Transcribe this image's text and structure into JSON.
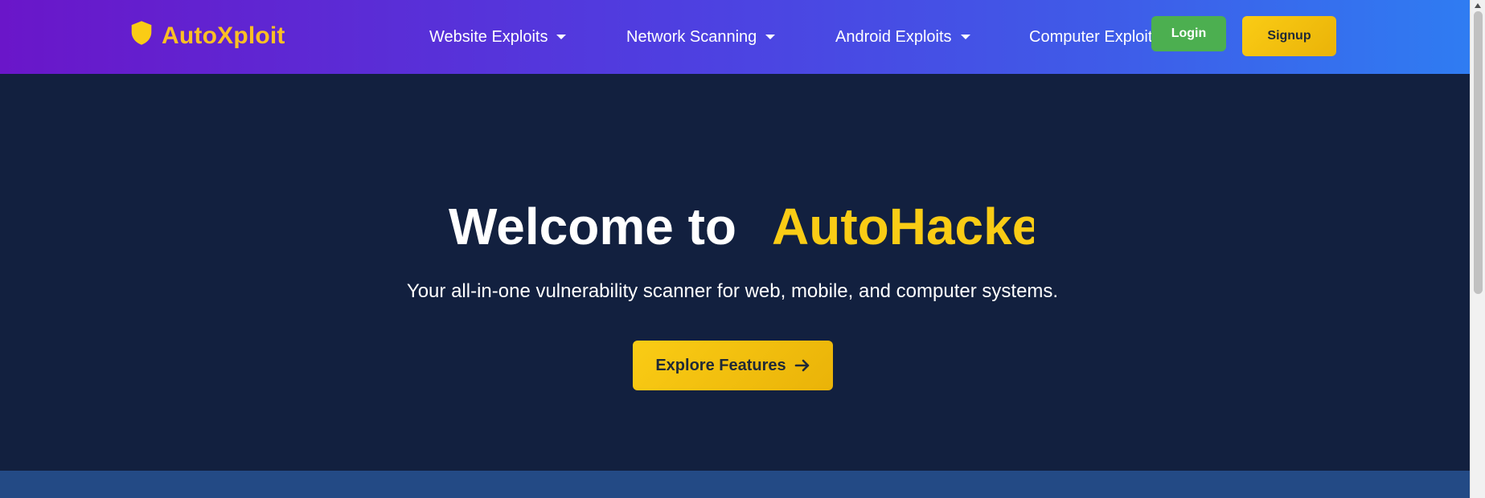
{
  "brand": {
    "name": "AutoXploit",
    "icon": "shield-icon"
  },
  "nav": {
    "items": [
      {
        "label": "Website Exploits",
        "icon": "caret-down-icon"
      },
      {
        "label": "Network Scanning",
        "icon": "caret-down-icon"
      },
      {
        "label": "Android Exploits",
        "icon": "caret-down-icon"
      },
      {
        "label": "Computer Exploits",
        "icon": "caret-down-icon"
      }
    ],
    "login_label": "Login",
    "signup_label": "Signup"
  },
  "hero": {
    "headline_prefix": "Welcome to",
    "headline_accent": "AutoHacker",
    "subtitle": "Your all-in-one vulnerability scanner for web, mobile, and computer systems.",
    "cta_label": "Explore Features",
    "cta_icon": "arrow-right-icon"
  },
  "colors": {
    "nav_gradient_start": "#6a16c9",
    "nav_gradient_end": "#2f7cf2",
    "brand_accent": "#fbbf24",
    "hero_background": "#12203f",
    "login_green": "#4caf50",
    "cta_yellow": "#facc15"
  }
}
